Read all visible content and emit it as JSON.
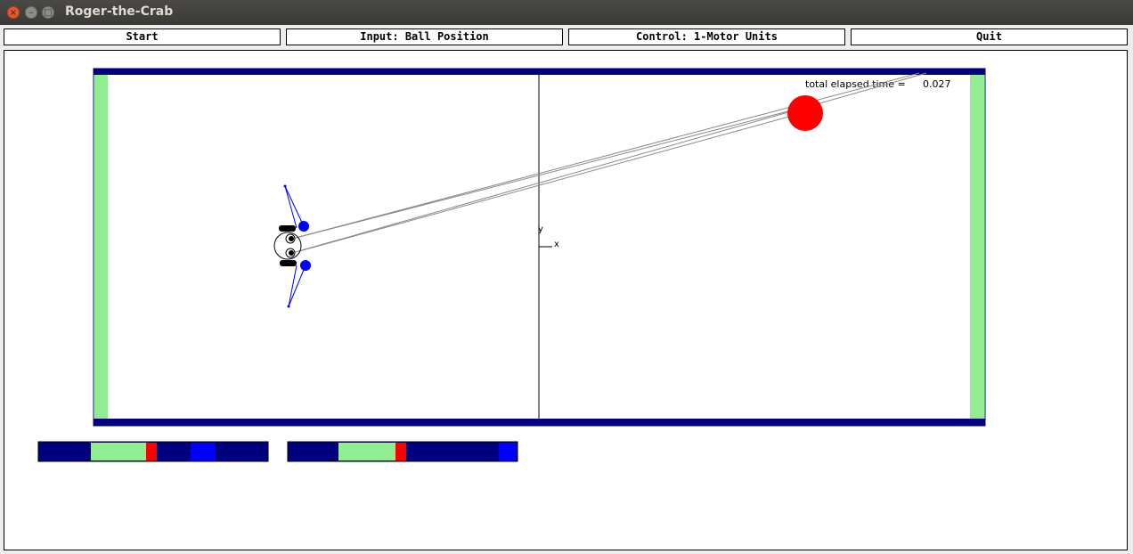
{
  "window": {
    "title": "Roger-the-Crab",
    "close_icon": "close-icon",
    "minimize_icon": "minimize-icon",
    "maximize_icon": "maximize-icon"
  },
  "menu": {
    "start": "Start",
    "input": "Input: Ball Position",
    "control": "Control: 1-Motor Units",
    "quit": "Quit"
  },
  "simulation": {
    "elapsed_label": "total elapsed time =",
    "elapsed_value": "0.027",
    "axis_x": "x",
    "axis_y": "y"
  },
  "colors": {
    "border": "#00007f",
    "wall": "#90ee90",
    "ball": "#ff0000",
    "eye": "#0000ff",
    "arm": "#0000ff"
  }
}
